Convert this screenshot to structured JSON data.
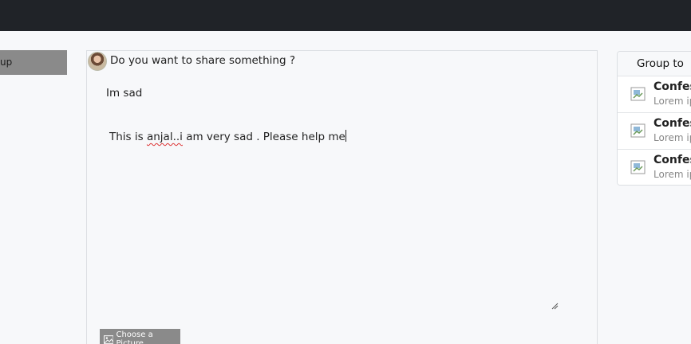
{
  "left_button": {
    "label": "up"
  },
  "composer": {
    "prompt": "Do you want to share something ?",
    "title_value": "Im sad",
    "body_before": "This is ",
    "body_misspelled": "anjal..i",
    "body_after": " am very sad . Please help me",
    "choose_picture_label": "Choose a Picture"
  },
  "group_panel": {
    "title": "Group to fo",
    "items": [
      {
        "title": "Confess",
        "subtitle": "Lorem ip"
      },
      {
        "title": "Confess",
        "subtitle": "Lorem ip"
      },
      {
        "title": "Confess",
        "subtitle": "Lorem ip"
      }
    ]
  },
  "colors": {
    "topbar": "#202328",
    "background": "#f7f8fa",
    "button_gray": "#8a8a8a"
  }
}
